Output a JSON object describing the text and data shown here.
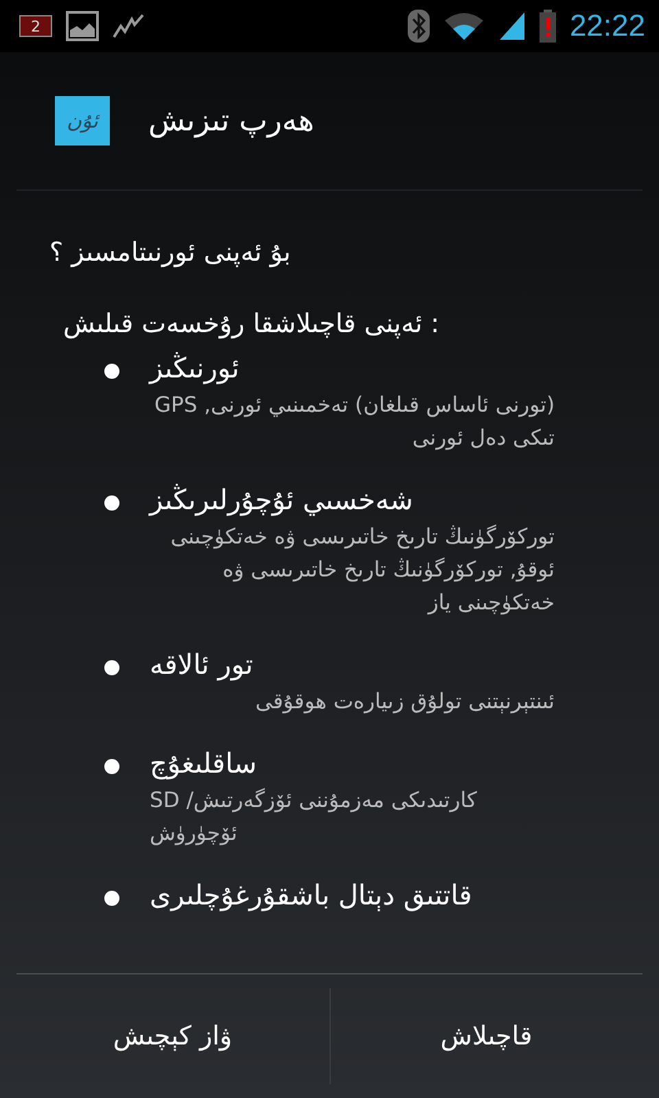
{
  "status_bar": {
    "battery_badge": "2",
    "time": "22:22"
  },
  "dialog": {
    "app_icon_text": "ئۇن",
    "title": "هەرپ تىزىش",
    "question": "بۇ ئەپنى ئورنىتامسىز ؟",
    "permissions_heading": "ئەپنى قاچىلاشقا رۇخسەت قىلىش :",
    "permissions": [
      {
        "title": "ئورنىڭىز",
        "description": "(تورنى ئاساس قىلغان) تەخمىنىي ئورنى, GPS تىكى دەل ئورنى"
      },
      {
        "title": "شەخسىي ئۇچۇرلىرىڭىز",
        "description": "توركۆرگۈنىڭ تارىخ خاتىرىسى ۋە خەتكۈچىنى ئوقۇ, توركۆرگۈنىڭ تارىخ خاتىرىسى ۋە خەتكۈچىنى ياز"
      },
      {
        "title": "تور ئالاقە",
        "description": "ئىنتېرنېتنى تولۇق زىيارەت ھوقۇقى"
      },
      {
        "title": "ساقلىغۇچ",
        "description": "SD كارتىدىكى مەزمۇننى ئۆزگەرتىش/ ئۆچۈرۈش"
      },
      {
        "title": "قاتتىق دېتال باشقۇرغۇچلىرى"
      }
    ],
    "buttons": [
      {
        "label": "قاچىلاش"
      },
      {
        "label": "ۋاز كېچىش"
      }
    ]
  }
}
